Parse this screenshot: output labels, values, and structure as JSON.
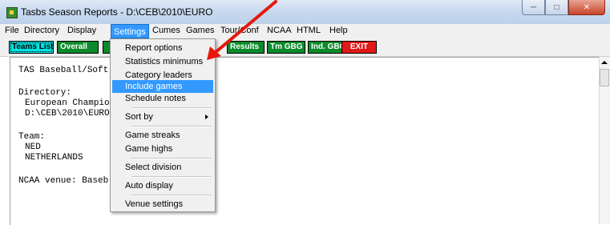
{
  "window": {
    "title": "Tasbs Season Reports - D:\\CEB\\2010\\EURO"
  },
  "menubar": {
    "items": [
      "File",
      "Directory",
      "Display",
      "Settings",
      "Cumes",
      "Games",
      "Tour/Conf",
      "NCAA",
      "HTML",
      "Help"
    ],
    "active": "Settings"
  },
  "toolbar": {
    "teams_list": "Teams List",
    "overall": "Overall",
    "results": "Results",
    "tm_gbg": "Tm GBG",
    "ind_gbg": "Ind. GBG",
    "exit": "EXIT"
  },
  "content": {
    "heading": "TAS Baseball/Soft",
    "directory_label": "Directory:",
    "directory_name": "European Champio",
    "directory_path": "D:\\CEB\\2010\\EURO",
    "team_label": "Team:",
    "team_code": "NED",
    "team_name": "NETHERLANDS",
    "venue": "NCAA venue: Baseb"
  },
  "settings_menu": {
    "items": [
      "Report options",
      "Statistics minimums",
      "Category leaders",
      "Include games",
      "Schedule notes",
      "Sort by",
      "Game streaks",
      "Game highs",
      "Select division",
      "Auto display",
      "Venue settings"
    ],
    "highlighted": "Include games"
  },
  "colors": {
    "highlight": "#3399ff",
    "annotation_arrow": "#e8160c"
  },
  "icons": {
    "window_controls": [
      "minimize-icon",
      "maximize-icon",
      "close-icon"
    ]
  }
}
